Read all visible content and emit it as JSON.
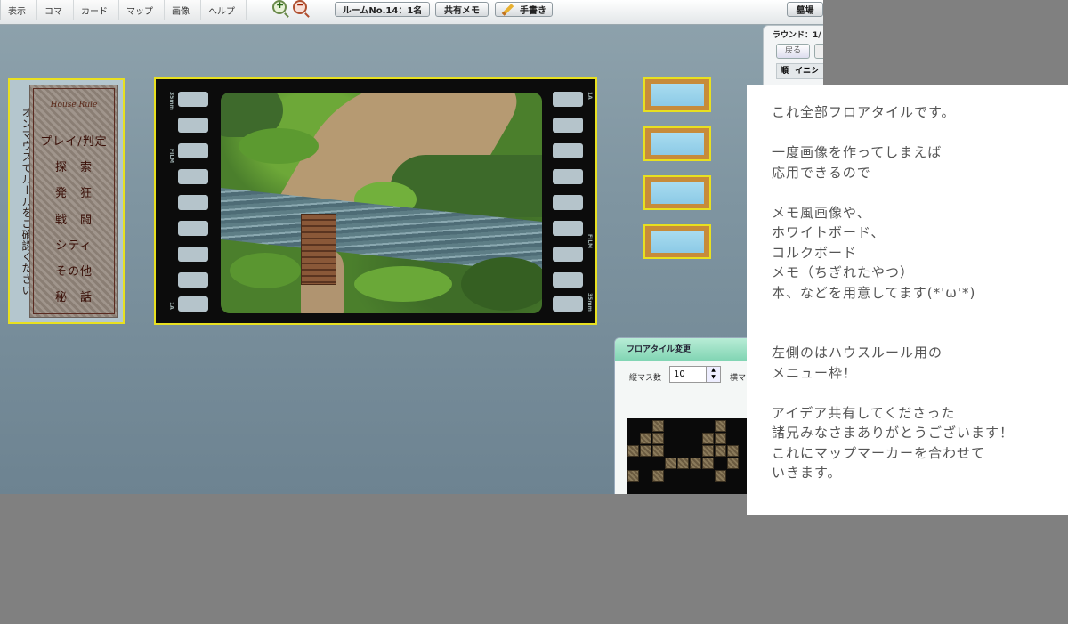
{
  "menubar": {
    "items": [
      "表示",
      "コマ",
      "カード",
      "マップ",
      "画像",
      "ヘルプ"
    ],
    "room_button": "ルームNo.14：1名",
    "shared_memo_button": "共有メモ",
    "handwrite_button": "手書き",
    "graveyard_button": "墓場"
  },
  "round_panel": {
    "title": "ラウンド：1/",
    "back_button": "戻る",
    "col_order": "順",
    "col_initiative": "イニシ"
  },
  "house_rule_menu": {
    "script_title": "House Rule",
    "items": [
      "プレイ/判定",
      "探　索",
      "発　狂",
      "戦　闘",
      "シティ",
      "その他",
      "秘　話"
    ],
    "vertical_note": "オンマウスでルールをご確認ください"
  },
  "film": {
    "top_left": "35mm",
    "top_right": "1A",
    "mid_left": "FILM",
    "mid_right": "FILM",
    "bottom_left": "1A",
    "bottom_right": "35mm"
  },
  "floor_tile_dialog": {
    "title": "フロアタイル変更",
    "rows_label": "縦マス数",
    "rows_value": "10",
    "cols_label": "横マ"
  },
  "memo": {
    "lines": [
      "これ全部フロアタイルです。",
      "",
      "一度画像を作ってしまえば",
      "応用できるので",
      "",
      "メモ風画像や、",
      "ホワイトボード、",
      "コルクボード",
      "メモ（ちぎれたやつ）",
      "本、などを用意してます(*'ω'*)",
      "",
      "",
      "左側のはハウスルール用の",
      "メニュー枠！",
      "",
      "アイデア共有してくださった",
      "諸兄みなさまありがとうございます！",
      "これにマップマーカーを合わせて",
      "いきます。"
    ]
  }
}
